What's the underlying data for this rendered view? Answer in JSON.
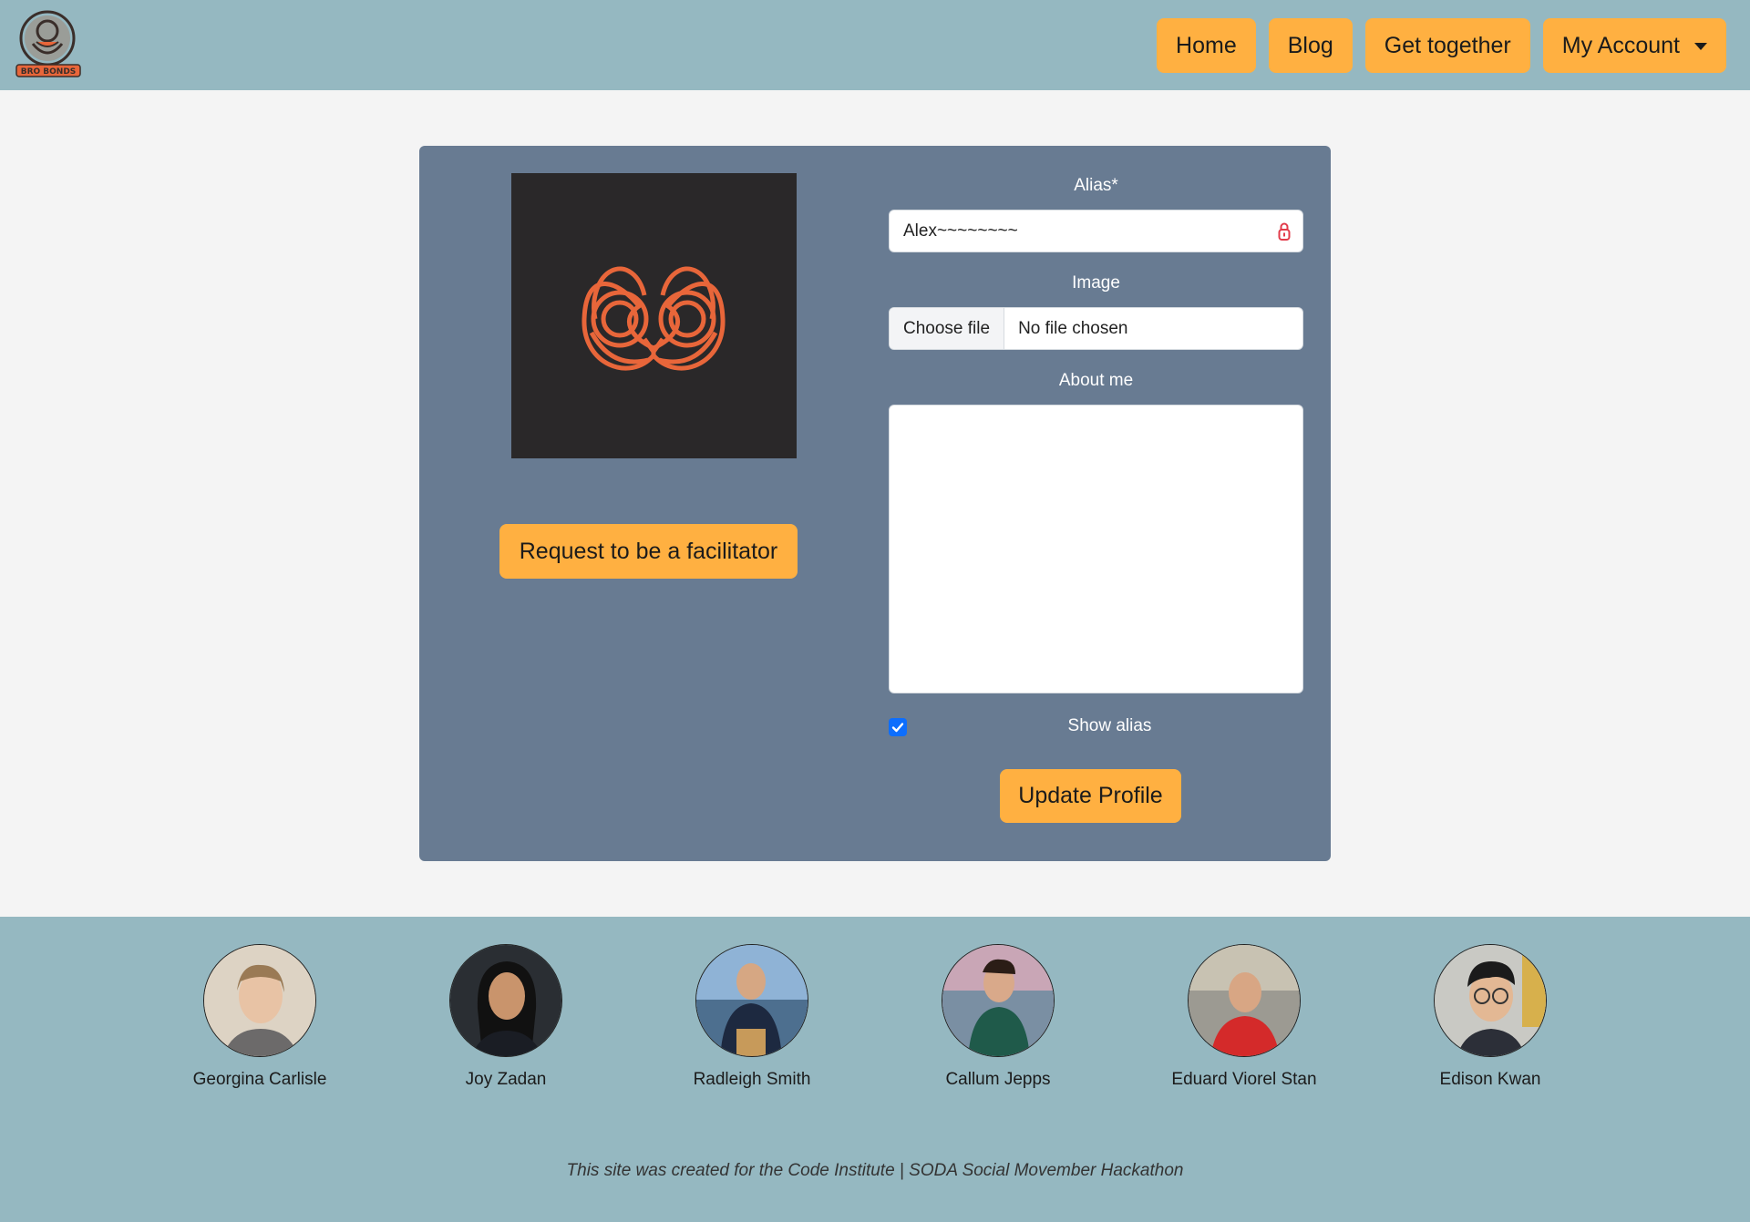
{
  "brand": {
    "logo_text": "BRO BONDS"
  },
  "nav": {
    "home": "Home",
    "blog": "Blog",
    "get_together": "Get together",
    "my_account": "My Account"
  },
  "profile": {
    "facilitator_button": "Request to be a facilitator",
    "alias_label": "Alias*",
    "alias_value": "Alex~~~~~~~~",
    "image_label": "Image",
    "choose_file": "Choose file",
    "no_file": "No file chosen",
    "about_label": "About me",
    "about_value": "",
    "show_alias_label": "Show alias",
    "show_alias_checked": true,
    "update_button": "Update Profile"
  },
  "team": [
    {
      "name": "Georgina Carlisle"
    },
    {
      "name": "Joy Zadan"
    },
    {
      "name": "Radleigh Smith"
    },
    {
      "name": "Callum Jepps"
    },
    {
      "name": "Eduard Viorel Stan"
    },
    {
      "name": "Edison Kwan"
    }
  ],
  "footer": {
    "note": "This site was created for the Code Institute | SODA Social Movember Hackathon"
  },
  "colors": {
    "navbar": "#95b8c1",
    "accent_button": "#ffb041",
    "card": "#687b92",
    "logo_orange": "#e8663a"
  }
}
